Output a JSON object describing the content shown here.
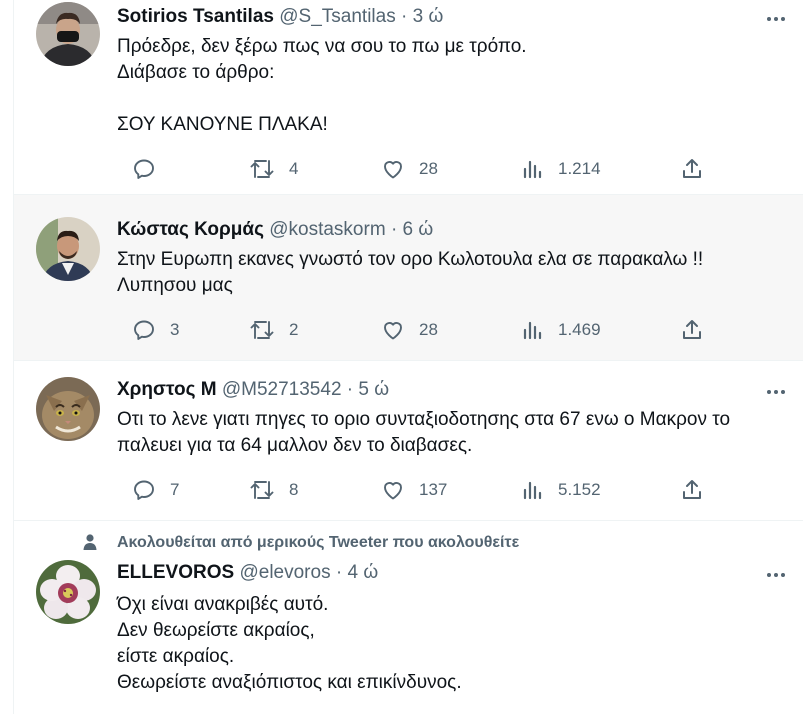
{
  "tweets": [
    {
      "name": "Sotirios Tsantilas",
      "handle": "@S_Tsantilas",
      "separator": "·",
      "age": "3 ώ",
      "lines": [
        "Πρόεδρε, δεν ξέρω πως να σου το πω με τρόπο.",
        "Διάβασε το άρθρο:",
        "",
        "ΣΟΥ ΚΑΝΟΥΝΕ ΠΛΑΚΑ!"
      ],
      "replies": "",
      "retweets": "4",
      "likes": "28",
      "views": "1.214"
    },
    {
      "name": "Κώστας Κορμάς",
      "handle": "@kostaskorm",
      "separator": "·",
      "age": "6 ώ",
      "lines": [
        "Στην Ευρωπη εκανες γνωστό τον ορο Κωλοτουλα ελα σε παρακαλω !!",
        "Λυπησου μας"
      ],
      "replies": "3",
      "retweets": "2",
      "likes": "28",
      "views": "1.469"
    },
    {
      "name": "Χρηστος Μ",
      "handle": "@M52713542",
      "separator": "·",
      "age": "5 ώ",
      "lines": [
        "Οτι το λενε γιατι πηγες το οριο συνταξιοδοτησης στα 67 ενω ο Μακρον το",
        "παλευει για τα 64 μαλλον δεν το διαβασες."
      ],
      "replies": "7",
      "retweets": "8",
      "likes": "137",
      "views": "5.152"
    },
    {
      "name": "ELLEVOROS",
      "handle": "@elevoros",
      "separator": "·",
      "age": "4 ώ",
      "lines": [
        "Όχι είναι ανακριβές αυτό.",
        "Δεν θεωρείστε ακραίος,",
        "είστε ακραίος.",
        "Θεωρείστε αναξιόπιστος και επικίνδυνος."
      ]
    }
  ],
  "social_context": "Ακολουθείται από μερικούς Tweeter που ακολουθείτε",
  "icons": {
    "reply": "reply-icon",
    "retweet": "retweet-icon",
    "like": "like-icon",
    "views": "views-icon",
    "share": "share-icon",
    "more": "more-icon",
    "person": "person-icon"
  },
  "colors": {
    "text": "#0f1419",
    "secondary": "#536471",
    "highlight_bg": "#f7f7f7",
    "border": "#eff3f4"
  }
}
